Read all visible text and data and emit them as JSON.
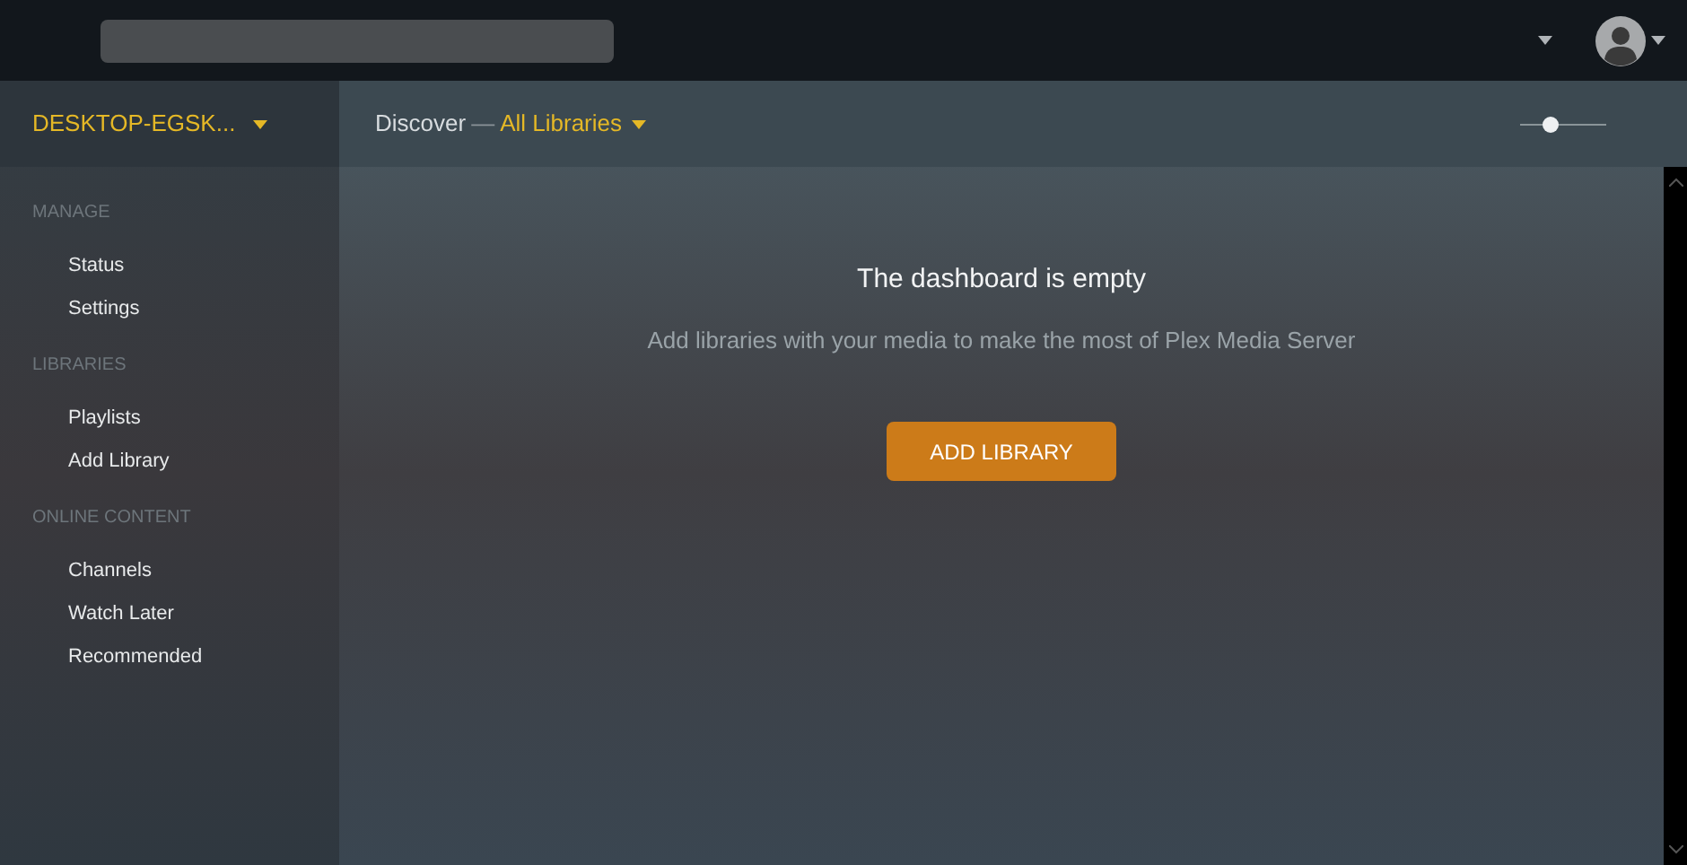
{
  "server": {
    "name": "DESKTOP-EGSK..."
  },
  "breadcrumb": {
    "section": "Discover",
    "separator": "—",
    "library": "All Libraries"
  },
  "zoom_slider": {
    "level": 0.35
  },
  "sidebar": {
    "groups": [
      {
        "heading": "MANAGE",
        "items": [
          "Status",
          "Settings"
        ]
      },
      {
        "heading": "LIBRARIES",
        "items": [
          "Playlists",
          "Add Library"
        ]
      },
      {
        "heading": "ONLINE CONTENT",
        "items": [
          "Channels",
          "Watch Later",
          "Recommended"
        ]
      }
    ]
  },
  "empty_state": {
    "title": "The dashboard is empty",
    "message": "Add libraries with your media to make the most of Plex Media Server",
    "button": "ADD LIBRARY"
  }
}
